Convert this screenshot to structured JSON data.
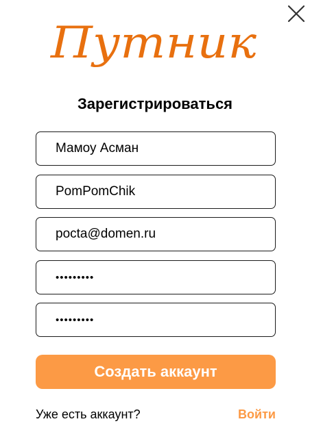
{
  "brand": {
    "name": "Путник",
    "color": "#e8700f"
  },
  "header": {
    "close_icon": "close-icon"
  },
  "form": {
    "title": "Зарегистрироваться",
    "name_value": "Мамоу Асман",
    "username_value": "PomPomChik",
    "email_value": "pocta@domen.ru",
    "password_value": "•••••••••",
    "password_confirm_value": "•••••••••"
  },
  "actions": {
    "submit_label": "Создать аккаунт",
    "submit_color": "#fc9a45"
  },
  "footer": {
    "question": "Уже есть аккаунт?",
    "login_label": "Войти",
    "login_color": "#fc9a45"
  }
}
